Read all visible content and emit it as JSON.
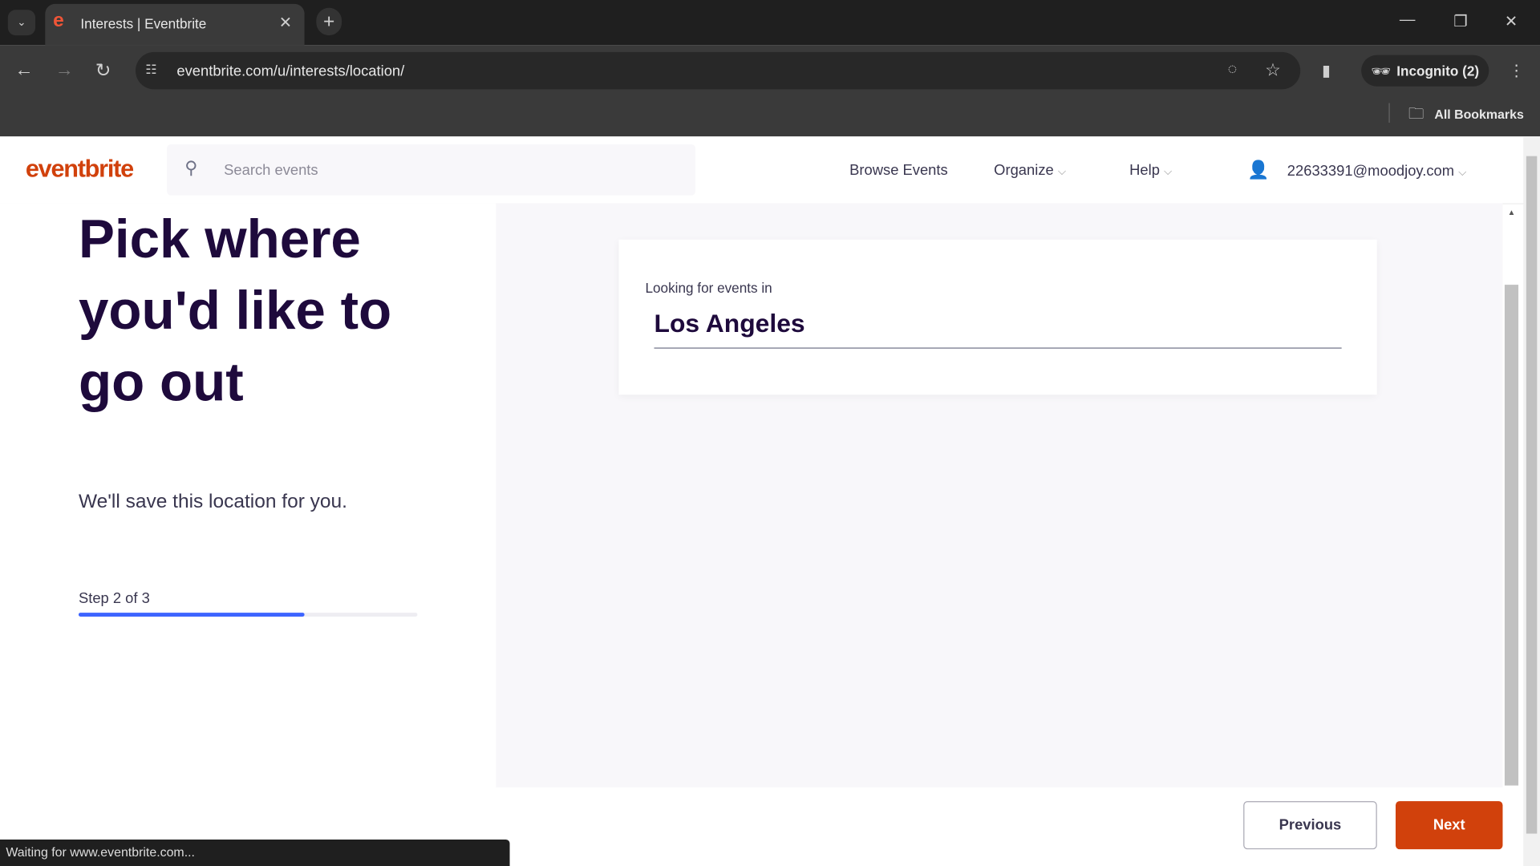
{
  "browser": {
    "tab_title": "Interests | Eventbrite",
    "url": "eventbrite.com/u/interests/location/",
    "profile": "Incognito (2)",
    "bookmarks": "All Bookmarks",
    "status": "Waiting for www.eventbrite.com..."
  },
  "header": {
    "logo": "eventbrite",
    "search_placeholder": "Search events",
    "nav": [
      "Browse Events",
      "Organize",
      "Help"
    ],
    "account": "22633391@moodjoy.com"
  },
  "main": {
    "title_lines": [
      "Pick where",
      "you'd like to",
      "go out"
    ],
    "subtitle": "We'll save this location for you.",
    "step": "Step 2 of 3",
    "progress_fraction": 0.667,
    "location_label": "Looking for events in",
    "location_value": "Los Angeles"
  },
  "footer": {
    "previous": "Previous",
    "next": "Next"
  },
  "colors": {
    "brand": "#d1410c",
    "progress": "#3d64ff",
    "title": "#1e0a3c"
  }
}
